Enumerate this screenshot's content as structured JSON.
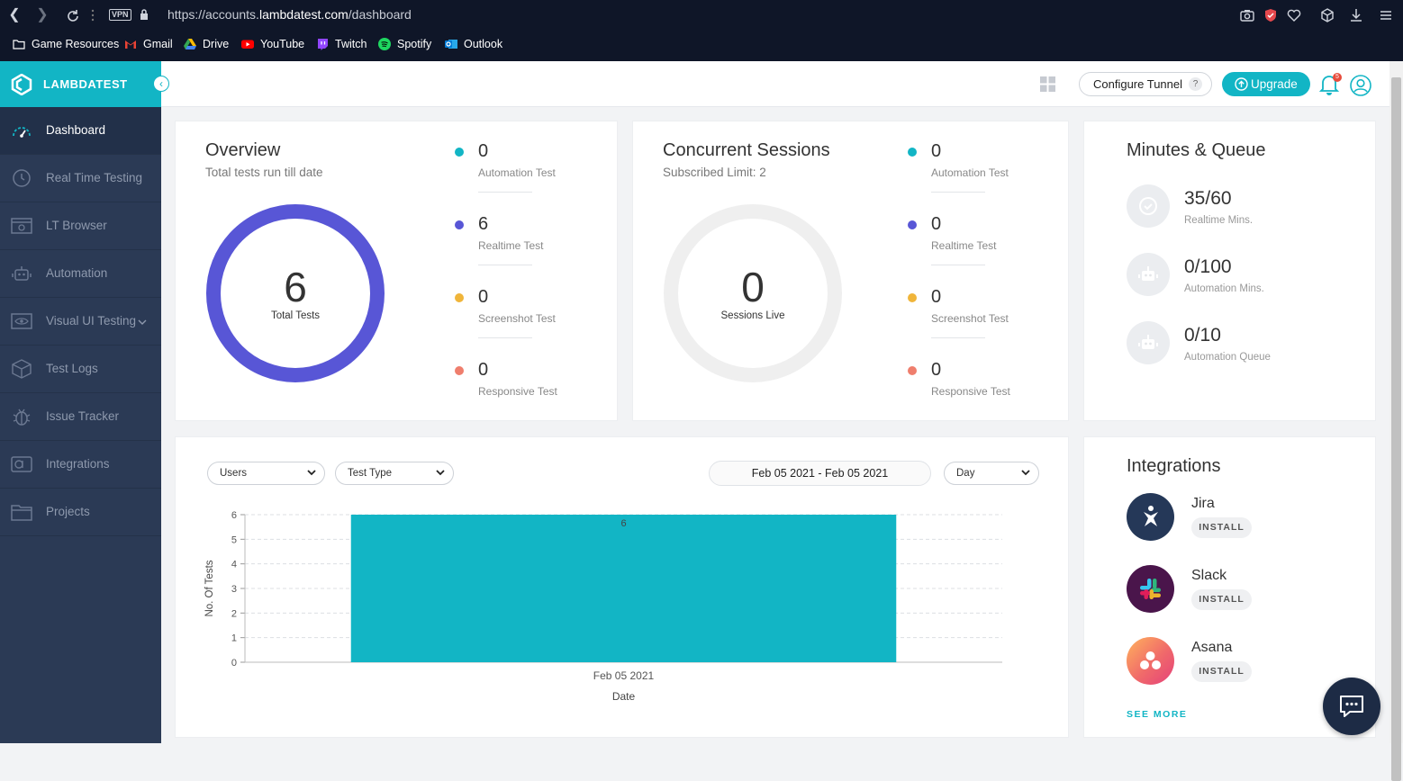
{
  "browser": {
    "url_prefix": "https://accounts.",
    "url_domain": "lambdatest.com",
    "url_path": "/dashboard",
    "vpn_label": "VPN",
    "bookmarks": [
      {
        "label": "Game Resources",
        "icon": "folder-icon"
      },
      {
        "label": "Gmail",
        "icon": "gmail-icon"
      },
      {
        "label": "Drive",
        "icon": "drive-icon"
      },
      {
        "label": "YouTube",
        "icon": "youtube-icon"
      },
      {
        "label": "Twitch",
        "icon": "twitch-icon"
      },
      {
        "label": "Spotify",
        "icon": "spotify-icon"
      },
      {
        "label": "Outlook",
        "icon": "outlook-icon"
      }
    ]
  },
  "sidebar": {
    "brand": "LAMBDATEST",
    "items": [
      {
        "label": "Dashboard",
        "icon": "gauge-icon",
        "active": true
      },
      {
        "label": "Real Time Testing",
        "icon": "clock-icon"
      },
      {
        "label": "LT Browser",
        "icon": "browser-icon"
      },
      {
        "label": "Automation",
        "icon": "robot-icon"
      },
      {
        "label": "Visual UI Testing",
        "icon": "eye-icon"
      },
      {
        "label": "Test Logs",
        "icon": "box-icon"
      },
      {
        "label": "Issue Tracker",
        "icon": "bug-icon"
      },
      {
        "label": "Integrations",
        "icon": "integrations-icon"
      },
      {
        "label": "Projects",
        "icon": "folder-icon"
      }
    ]
  },
  "topbar": {
    "configure_tunnel": "Configure Tunnel",
    "tunnel_help": "?",
    "upgrade": "Upgrade",
    "notification_count": "5"
  },
  "overview": {
    "title": "Overview",
    "subtitle": "Total tests run till date",
    "total": "6",
    "total_label": "Total Tests",
    "stats": [
      {
        "value": "0",
        "label": "Automation Test",
        "color": "#12b5c5"
      },
      {
        "value": "6",
        "label": "Realtime Test",
        "color": "#5856d6"
      },
      {
        "value": "0",
        "label": "Screenshot Test",
        "color": "#f0b53a"
      },
      {
        "value": "0",
        "label": "Responsive Test",
        "color": "#ef7e6d"
      }
    ],
    "ring_color": "#5856d6"
  },
  "concurrent": {
    "title": "Concurrent Sessions",
    "subtitle": "Subscribed Limit: 2",
    "total": "0",
    "total_label": "Sessions Live",
    "stats": [
      {
        "value": "0",
        "label": "Automation Test",
        "color": "#12b5c5"
      },
      {
        "value": "0",
        "label": "Realtime Test",
        "color": "#5856d6"
      },
      {
        "value": "0",
        "label": "Screenshot Test",
        "color": "#f0b53a"
      },
      {
        "value": "0",
        "label": "Responsive Test",
        "color": "#ef7e6d"
      }
    ]
  },
  "minutes": {
    "title": "Minutes & Queue",
    "items": [
      {
        "value": "35/60",
        "label": "Realtime Mins.",
        "icon": "realtime-icon"
      },
      {
        "value": "0/100",
        "label": "Automation Mins.",
        "icon": "robot-icon"
      },
      {
        "value": "0/10",
        "label": "Automation Queue",
        "icon": "robot-icon"
      }
    ]
  },
  "filters": {
    "users": "Users",
    "test_type": "Test Type",
    "date_range": "Feb 05 2021 - Feb 05 2021",
    "granularity": "Day"
  },
  "chart_data": {
    "type": "bar",
    "categories": [
      "Feb 05 2021"
    ],
    "values": [
      6
    ],
    "data_labels": [
      "6"
    ],
    "xlabel": "Date",
    "ylabel": "No. Of Tests",
    "ylim": [
      0,
      6
    ],
    "yticks": [
      "0",
      "1",
      "2",
      "3",
      "4",
      "5",
      "6"
    ],
    "bar_color": "#12b5c5",
    "grid": true
  },
  "integrations": {
    "title": "Integrations",
    "items": [
      {
        "name": "Jira",
        "action": "INSTALL",
        "color": "#253858"
      },
      {
        "name": "Slack",
        "action": "INSTALL",
        "color": "#4a154b"
      },
      {
        "name": "Asana",
        "action": "INSTALL",
        "color": "#f06a6a"
      }
    ],
    "see_more": "SEE MORE"
  }
}
